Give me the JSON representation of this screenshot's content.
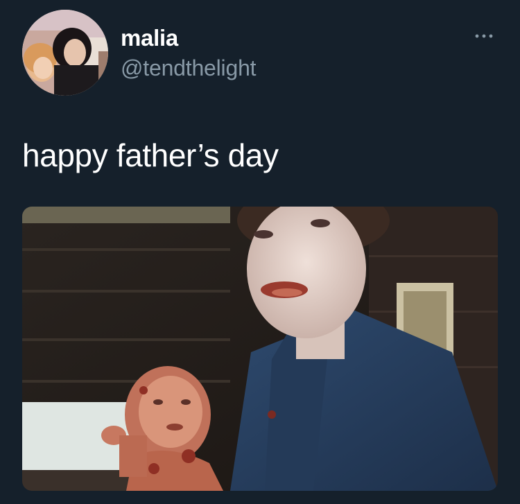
{
  "user": {
    "display_name": "malia",
    "handle": "@tendthelight"
  },
  "tweet": {
    "text": "happy father’s day"
  },
  "icons": {
    "avatar": "profile-photo",
    "more": "more-options-icon"
  },
  "colors": {
    "background": "#15202b",
    "secondary_text": "#8899a6",
    "primary_text": "#ffffff"
  }
}
